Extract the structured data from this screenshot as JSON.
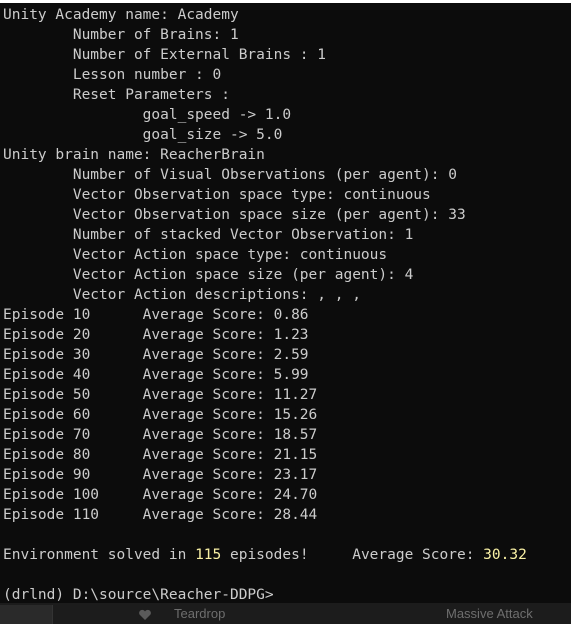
{
  "terminal": {
    "lines": [
      "Unity Academy name: Academy",
      "        Number of Brains: 1",
      "        Number of External Brains : 1",
      "        Lesson number : 0",
      "        Reset Parameters :",
      "                goal_speed -> 1.0",
      "                goal_size -> 5.0",
      "Unity brain name: ReacherBrain",
      "        Number of Visual Observations (per agent): 0",
      "        Vector Observation space type: continuous",
      "        Vector Observation space size (per agent): 33",
      "        Number of stacked Vector Observation: 1",
      "        Vector Action space type: continuous",
      "        Vector Action space size (per agent): 4",
      "        Vector Action descriptions: , , ,"
    ],
    "episodes": [
      "Episode 10      Average Score: 0.86",
      "Episode 20      Average Score: 1.23",
      "Episode 30      Average Score: 2.59",
      "Episode 40      Average Score: 5.99",
      "Episode 50      Average Score: 11.27",
      "Episode 60      Average Score: 15.26",
      "Episode 70      Average Score: 18.57",
      "Episode 80      Average Score: 21.15",
      "Episode 90      Average Score: 23.17",
      "Episode 100     Average Score: 24.70",
      "Episode 110     Average Score: 28.44"
    ],
    "solved": {
      "prefix": "Environment solved in ",
      "episodes": "115",
      "middle": " episodes!     Average Score: ",
      "score": "30.32"
    },
    "prompt": "(drlnd) D:\\source\\Reacher-DDPG>"
  },
  "taskbar": {
    "track_title": "Teardrop",
    "artist": "Massive Attack"
  },
  "colors": {
    "background": "#0c0c0c",
    "text": "#cccccc",
    "highlight": "#f9f1a5"
  }
}
